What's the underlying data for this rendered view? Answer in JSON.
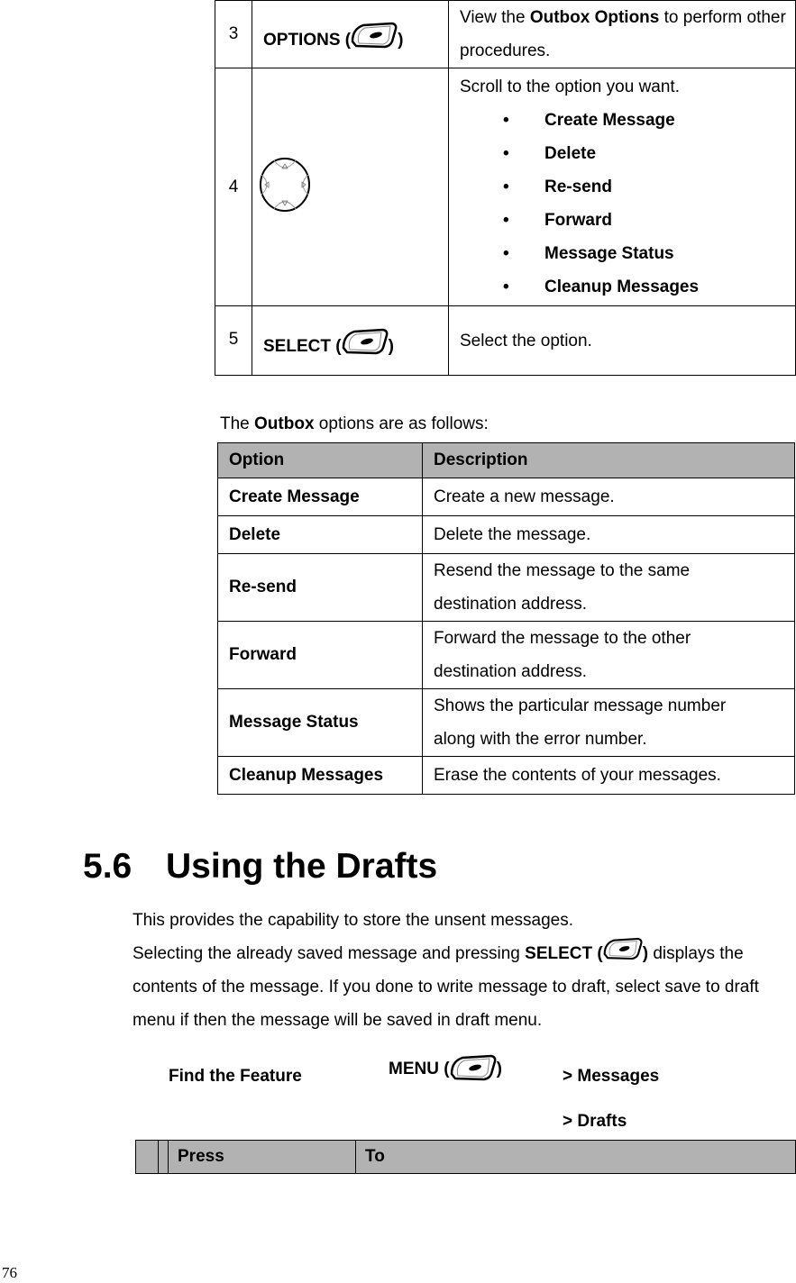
{
  "step_table": {
    "rows": [
      {
        "num": "3",
        "key_label": "OPTIONS (",
        "key_close": ")",
        "key_icon": "softkey-icon",
        "desc_pre": "View the ",
        "desc_bold": "Outbox Options",
        "desc_post": " to perform other procedures."
      },
      {
        "num": "4",
        "key_icon": "nav-key-icon",
        "desc_intro": "Scroll to the option you want.",
        "bullets": [
          "Create Message",
          "Delete",
          "Re-send",
          "Forward",
          "Message Status",
          "Cleanup Messages"
        ]
      },
      {
        "num": "5",
        "key_label": "SELECT (",
        "key_close": ")",
        "key_icon": "softkey-icon",
        "desc": "Select the option."
      }
    ]
  },
  "outbox": {
    "intro_pre": "The ",
    "intro_bold": "Outbox",
    "intro_post": " options are as follows:",
    "headers": [
      "Option",
      "Description"
    ],
    "rows": [
      {
        "option": "Create Message",
        "description": "Create a new message."
      },
      {
        "option": "Delete",
        "description": "Delete the message."
      },
      {
        "option": "Re-send",
        "description": "Resend the message to the same destination address."
      },
      {
        "option": "Forward",
        "description": "Forward the message to the other destination address."
      },
      {
        "option": "Message Status",
        "description": "Shows the particular message number along with the error number."
      },
      {
        "option": "Cleanup Messages",
        "description": "Erase the contents of your messages."
      }
    ]
  },
  "section": {
    "number": "5.6",
    "title": "Using the Drafts",
    "para1": "This provides the capability to store the unsent messages.",
    "para2_pre": "Selecting the already saved message and pressing ",
    "para2_bold": "SELECT (",
    "para2_bold_close": ")",
    "para2_post": " displays the contents of the message. If you done to write message to draft, select save to draft menu if then the message will be saved in draft menu."
  },
  "find_feature": {
    "label": "Find the Feature",
    "menu_label": "MENU (",
    "menu_close": ")",
    "path": [
      "> Messages",
      "> Drafts"
    ]
  },
  "press_table": {
    "headers": [
      "",
      "Press",
      "To"
    ]
  },
  "page_number": "76"
}
